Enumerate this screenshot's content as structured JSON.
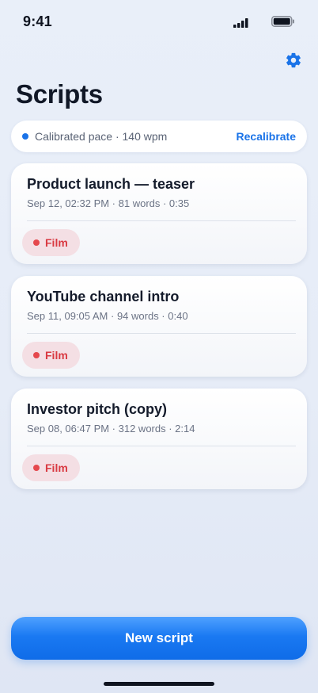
{
  "status_bar": {
    "time": "9:41",
    "icons": [
      "signal-icon",
      "battery-icon"
    ]
  },
  "header": {
    "title": "Scripts",
    "settings_icon": "gear-icon"
  },
  "pace": {
    "text": "Calibrated pace · 140 wpm",
    "action_label": "Recalibrate"
  },
  "scripts": [
    {
      "title": "Product launch — teaser",
      "meta": "Sep 12, 02:32 PM · 81 words · 0:35",
      "tag": "Film"
    },
    {
      "title": "YouTube channel intro",
      "meta": "Sep 11, 09:05 AM · 94 words · 0:40",
      "tag": "Film"
    },
    {
      "title": "Investor pitch (copy)",
      "meta": "Sep 08, 06:47 PM · 312 words · 2:14",
      "tag": "Film"
    }
  ],
  "footer": {
    "new_script_label": "New script"
  },
  "colors": {
    "accent": "#1a73e8",
    "tag_text": "#d93a42",
    "tag_bg": "#f4dfe4"
  }
}
